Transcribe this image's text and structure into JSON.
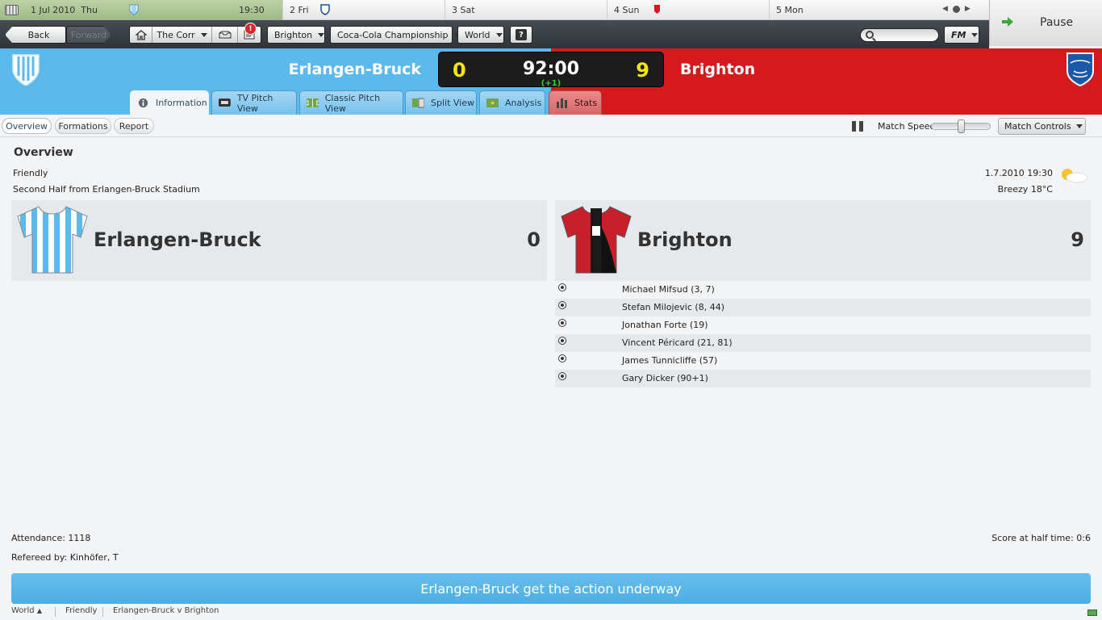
{
  "calendar": {
    "today": {
      "date": "1 Jul 2010",
      "day": "Thu",
      "time": "19:30"
    },
    "days": [
      {
        "num": "2",
        "label": "Fri"
      },
      {
        "num": "3",
        "label": "Sat"
      },
      {
        "num": "4",
        "label": "Sun"
      },
      {
        "num": "5",
        "label": "Mon"
      }
    ]
  },
  "pause": {
    "label": "Pause"
  },
  "nav": {
    "back": "Back",
    "forward": "Forward",
    "club_menu": "The Corr",
    "alert_count": "!",
    "team_menu": "Brighton",
    "competition_menu": "Coca-Cola Championship",
    "world_menu": "World",
    "help": "?",
    "fm_menu": "FM"
  },
  "match": {
    "home_team": "Erlangen-Bruck",
    "away_team": "Brighton",
    "home_score": "0",
    "away_score": "9",
    "clock": "92:00",
    "added_time": "(+1)",
    "colors": {
      "home": "#5cb9ec",
      "away": "#d51a1e",
      "score": "#f6e510",
      "added_time": "#39d12b"
    }
  },
  "tabs": [
    {
      "label": "Information",
      "icon": "info-icon"
    },
    {
      "label": "TV Pitch View",
      "icon": "tv-icon"
    },
    {
      "label": "Classic Pitch View",
      "icon": "pitch-icon"
    },
    {
      "label": "Split View",
      "icon": "split-icon"
    },
    {
      "label": "Analysis",
      "icon": "analysis-icon"
    },
    {
      "label": "Stats",
      "icon": "stats-icon"
    }
  ],
  "subtabs": [
    "Overview",
    "Formations",
    "Report"
  ],
  "controls": {
    "speed_label": "Match Speed",
    "speed_value": 0.5,
    "match_controls": "Match Controls"
  },
  "overview": {
    "title": "Overview",
    "competition": "Friendly",
    "venue": "Second Half from Erlangen-Bruck Stadium",
    "datetime": "1.7.2010 19:30",
    "weather": "Breezy 18°C",
    "home": {
      "name": "Erlangen-Bruck",
      "score": "0"
    },
    "away": {
      "name": "Brighton",
      "score": "9"
    },
    "scorers": [
      {
        "text": "Michael Mifsud (3, 7)"
      },
      {
        "text": "Stefan Milojevic (8, 44)"
      },
      {
        "text": "Jonathan Forte (19)"
      },
      {
        "text": "Vincent Péricard (21, 81)"
      },
      {
        "text": "James Tunnicliffe (57)"
      },
      {
        "text": "Gary Dicker (90+1)"
      }
    ],
    "attendance": "Attendance: 1118",
    "referee": "Refereed by: Kinhöfer, T",
    "halftime": "Score at half time: 0:6"
  },
  "commentary": "Erlangen-Bruck get the action underway",
  "statusbar": {
    "world": "World",
    "competition": "Friendly",
    "fixture": "Erlangen-Bruck v Brighton"
  }
}
